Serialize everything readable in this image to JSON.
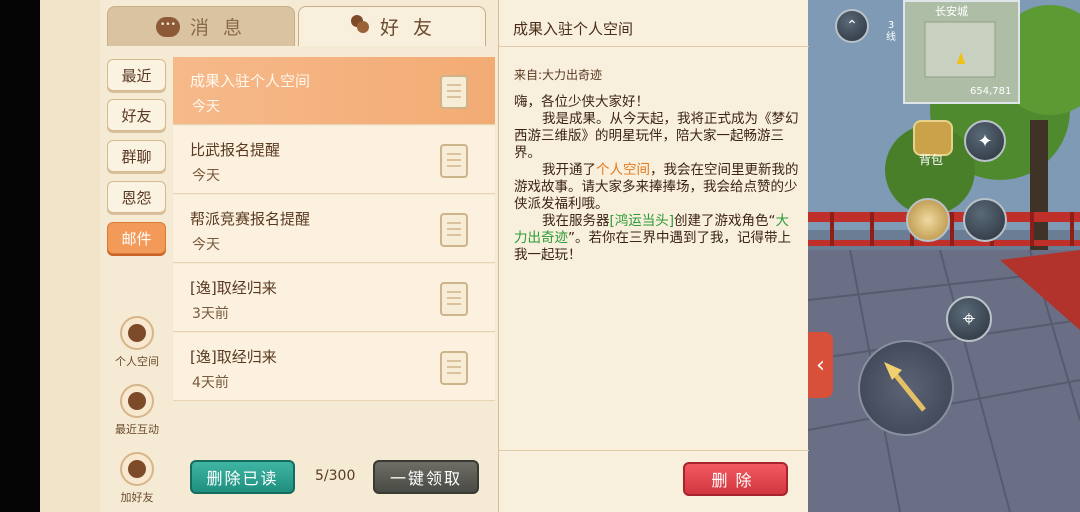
{
  "tabs": {
    "messages": "消 息",
    "friends": "好 友"
  },
  "categories": [
    "最近",
    "好友",
    "群聊",
    "恩怨",
    "邮件"
  ],
  "side_actions": {
    "personal_space": "个人空间",
    "recent_interaction": "最近互动",
    "add_friend": "加好友"
  },
  "mails": [
    {
      "title": "成果入驻个人空间",
      "time": "今天"
    },
    {
      "title": "比武报名提醒",
      "time": "今天"
    },
    {
      "title": "帮派竞赛报名提醒",
      "time": "今天"
    },
    {
      "title": "[逸]取经归来",
      "time": "3天前"
    },
    {
      "title": "[逸]取经归来",
      "time": "4天前"
    }
  ],
  "list_footer": {
    "delete_read": "删除已读",
    "count": "5/300",
    "collect_all": "一键领取"
  },
  "detail": {
    "title": "成果入驻个人空间",
    "from": "来自:大力出奇迹",
    "body": {
      "greeting": "嗨，各位少侠大家好！",
      "p1": "我是成果。从今天起，我将正式成为《梦幻西游三维版》的明星玩伴，陪大家一起畅游三界。",
      "p2_before": "我开通了",
      "p2_link": "个人空间",
      "p2_after": "，我会在空间里更新我的游戏故事。请大家多来捧捧场，我会给点赞的少侠派发福利哦。",
      "p3_before": "我在服务器",
      "p3_server": "[鸿运当头]",
      "p3_mid": "创建了游戏角色“",
      "p3_role": "大力出奇迹",
      "p3_after": "”。若你在三界中遇到了我，记得带上我一起玩！"
    },
    "delete": "删除"
  },
  "hud": {
    "city": "长安城",
    "coords": "654,781",
    "line": "3线",
    "bag": "背包",
    "collapse": "‹"
  },
  "colors": {
    "active_tab": "#f39a58",
    "delete_read_button": "#1f8f7f",
    "delete_button": "#d23640",
    "server_text": "#2b9b35",
    "link_text": "#e07a1e"
  }
}
